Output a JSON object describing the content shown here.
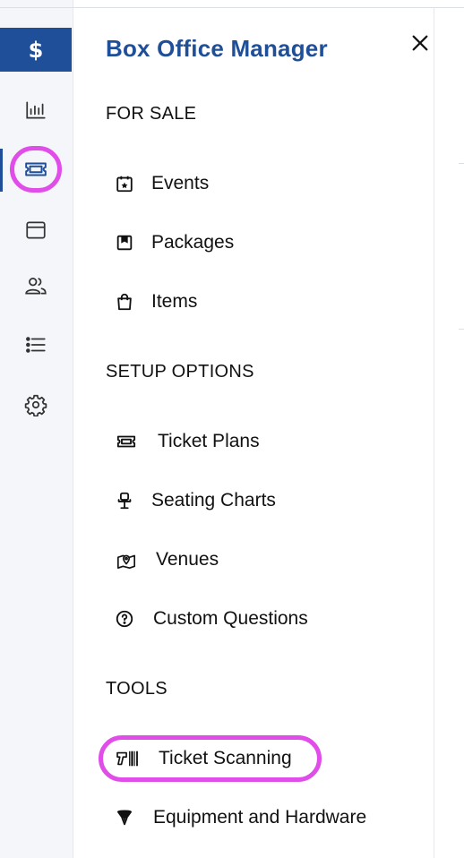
{
  "brand": {
    "symbol": "$",
    "color": "#1f4f99"
  },
  "rail": {
    "items": [
      {
        "icon": "bar-chart-icon"
      },
      {
        "icon": "ticket-icon",
        "active": true
      },
      {
        "icon": "browser-window-icon"
      },
      {
        "icon": "users-icon"
      },
      {
        "icon": "list-icon"
      },
      {
        "icon": "gear-icon"
      }
    ]
  },
  "drawer": {
    "title": "Box Office Manager",
    "close_icon": "close-icon",
    "sections": {
      "for_sale": "FOR SALE",
      "setup_options": "SETUP OPTIONS",
      "tools": "TOOLS"
    },
    "for_sale_items": [
      {
        "label": "Events",
        "icon": "calendar-star-icon"
      },
      {
        "label": "Packages",
        "icon": "package-icon"
      },
      {
        "label": "Items",
        "icon": "shopping-bag-icon"
      }
    ],
    "setup_items": [
      {
        "label": "Ticket Plans",
        "icon": "ticket-icon"
      },
      {
        "label": "Seating Charts",
        "icon": "chair-icon"
      },
      {
        "label": "Venues",
        "icon": "map-pin-icon"
      },
      {
        "label": "Custom Questions",
        "icon": "question-circle-icon"
      }
    ],
    "tools_items": [
      {
        "label": "Ticket Scanning",
        "icon": "barcode-scanner-icon"
      },
      {
        "label": "Equipment and Hardware",
        "icon": "hardware-icon"
      }
    ]
  },
  "highlight_color": "#e04de8"
}
